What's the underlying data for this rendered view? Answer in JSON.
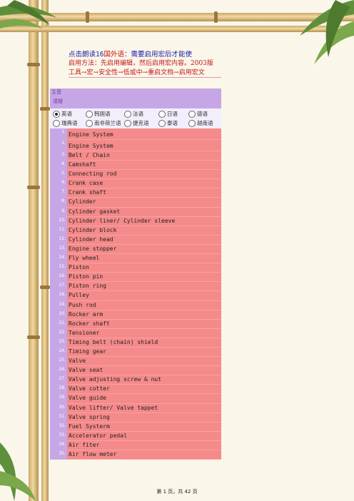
{
  "header": {
    "line1_prefix": "点击朗读16",
    "line1_red": "国外语",
    "line1_suffix": "：需要启用宏后才能使",
    "line2": "启用方法：先启用编辑，然后启用宏内容。2003版",
    "line3": "工具→宏→安全性→低或中→重启文档→启用宏文"
  },
  "panel": {
    "title": "主音",
    "subtitle": "请按"
  },
  "languages": {
    "row1": [
      "英语",
      "韩国语",
      "法语",
      "日语",
      "德语"
    ],
    "row2": [
      "瑞典语",
      "南非荷兰语",
      "捷克语",
      "泰语",
      "越南语"
    ],
    "selected": "英语"
  },
  "terms": [
    {
      "n": "1.",
      "t": "Engine System"
    },
    {
      "n": "2.",
      "t": "Engine System"
    },
    {
      "n": "3.",
      "t": "Belt / Chain"
    },
    {
      "n": "4.",
      "t": "Camshaft"
    },
    {
      "n": "5.",
      "t": "Connecting rod"
    },
    {
      "n": "6.",
      "t": "Crank case"
    },
    {
      "n": "7.",
      "t": "Crank shaft"
    },
    {
      "n": "8.",
      "t": "Cylinder"
    },
    {
      "n": "9.",
      "t": "Cylinder  gasket"
    },
    {
      "n": "10.",
      "t": "Cylinder  liner/ Cylinder sleeve"
    },
    {
      "n": "11.",
      "t": "Cylinder block"
    },
    {
      "n": "12.",
      "t": "Cylinder head"
    },
    {
      "n": "13.",
      "t": "Engine stopper"
    },
    {
      "n": "14.",
      "t": "Fly wheel"
    },
    {
      "n": "15.",
      "t": "Piston"
    },
    {
      "n": "16.",
      "t": "Piston pin"
    },
    {
      "n": "17.",
      "t": "Piston ring"
    },
    {
      "n": "18.",
      "t": "Pulley"
    },
    {
      "n": "19.",
      "t": "Push rod"
    },
    {
      "n": "20.",
      "t": "Rocker arm"
    },
    {
      "n": "21.",
      "t": "Rocker shaft"
    },
    {
      "n": "22.",
      "t": "Tensioner"
    },
    {
      "n": "23.",
      "t": "Timing belt (chain) shield"
    },
    {
      "n": "24.",
      "t": "Timing gear"
    },
    {
      "n": "25.",
      "t": "Valve"
    },
    {
      "n": "26.",
      "t": "Valve  seat"
    },
    {
      "n": "27.",
      "t": "Valve adjusting screw & nut"
    },
    {
      "n": "28.",
      "t": "Valve cotter"
    },
    {
      "n": "29.",
      "t": "Valve guide"
    },
    {
      "n": "30.",
      "t": "Valve lifter/ Valve tappet"
    },
    {
      "n": "31.",
      "t": "Valve spring"
    },
    {
      "n": "32.",
      "t": "Fuel Systerm"
    },
    {
      "n": "33.",
      "t": "Accelerator pedal"
    },
    {
      "n": "34.",
      "t": "Air fiter"
    },
    {
      "n": "35.",
      "t": "Air flow meter"
    }
  ],
  "footer": "第 1 页，共 42 页"
}
